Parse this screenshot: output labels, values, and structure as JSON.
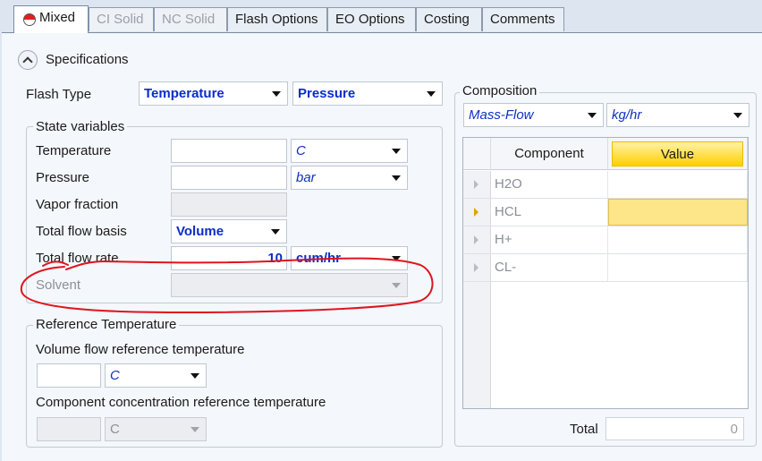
{
  "tabs": [
    {
      "label": "Mixed",
      "state": "active"
    },
    {
      "label": "CI Solid",
      "state": "disabled"
    },
    {
      "label": "NC Solid",
      "state": "disabled"
    },
    {
      "label": "Flash Options",
      "state": "normal"
    },
    {
      "label": "EO Options",
      "state": "normal"
    },
    {
      "label": "Costing",
      "state": "normal"
    },
    {
      "label": "Comments",
      "state": "normal"
    }
  ],
  "specifications": {
    "title": "Specifications",
    "flash_type_label": "Flash Type",
    "flash_type_1": "Temperature",
    "flash_type_2": "Pressure",
    "state_variables": {
      "title": "State variables",
      "temperature_label": "Temperature",
      "temperature_value": "",
      "temperature_unit": "C",
      "pressure_label": "Pressure",
      "pressure_value": "",
      "pressure_unit": "bar",
      "vapor_fraction_label": "Vapor fraction",
      "vapor_fraction_value": "",
      "total_flow_basis_label": "Total flow basis",
      "total_flow_basis_value": "Volume",
      "total_flow_rate_label": "Total flow rate",
      "total_flow_rate_value": "10",
      "total_flow_rate_unit": "cum/hr",
      "solvent_label": "Solvent",
      "solvent_value": ""
    },
    "reference_temperature": {
      "title": "Reference Temperature",
      "volume_flow_label": "Volume flow reference temperature",
      "volume_flow_value": "",
      "volume_flow_unit": "C",
      "component_conc_label": "Component concentration reference temperature",
      "component_conc_value": "",
      "component_conc_unit": "C"
    }
  },
  "composition": {
    "title": "Composition",
    "basis": "Mass-Flow",
    "unit": "kg/hr",
    "columns": [
      "Component",
      "Value"
    ],
    "rows": [
      {
        "component": "H2O",
        "value": ""
      },
      {
        "component": "HCL",
        "value": ""
      },
      {
        "component": "H+",
        "value": ""
      },
      {
        "component": "CL-",
        "value": ""
      }
    ],
    "total_label": "Total",
    "total_value": "0"
  },
  "colors": {
    "annotation": "#e0141e",
    "value_header": "#ffd000",
    "selected_cell": "#fde58a"
  }
}
